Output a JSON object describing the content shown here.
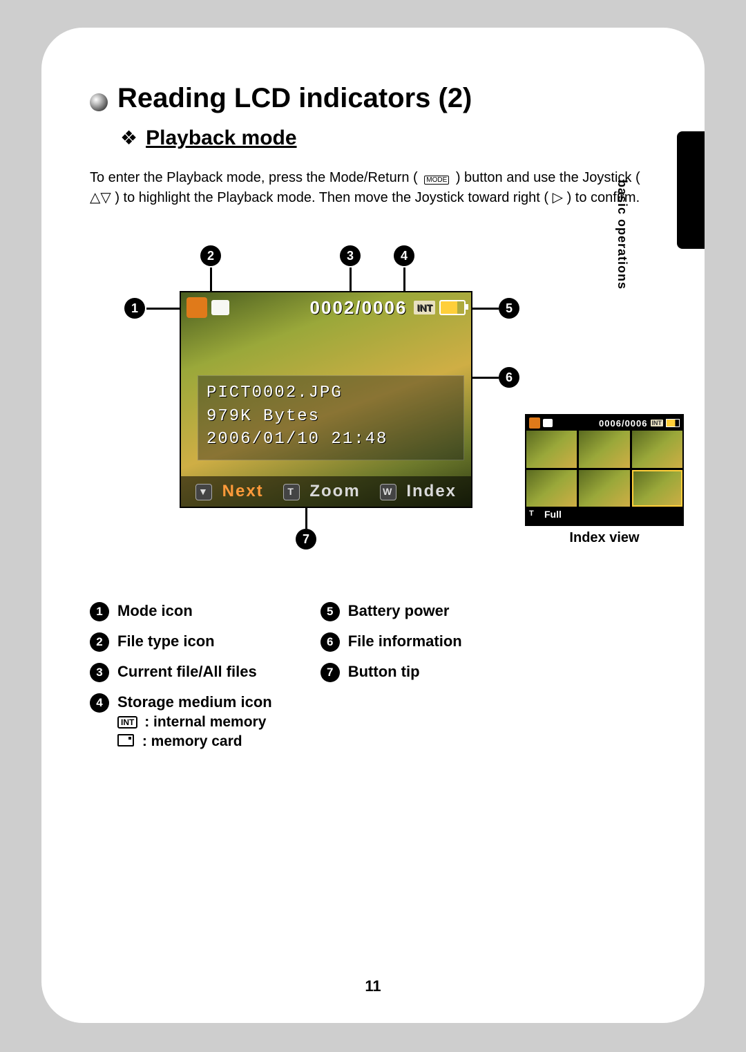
{
  "side_tab_label": "basic operations",
  "title": "Reading LCD indicators (2)",
  "subtitle": "Playback mode",
  "intro_parts": {
    "a": "To enter the Playback mode, press the Mode/Return (",
    "mode_icon_text": "MODE",
    "b": ") button and use the Joystick (",
    "joy_glyph": "△▽",
    "c": ") to highlight the Playback mode. Then move the Joystick toward right (",
    "right_glyph": "▷",
    "d": ") to confirm."
  },
  "lcd": {
    "counter": "0002/0006",
    "int_label": "INT",
    "file_name": "PICT0002.JPG",
    "file_size": "979K Bytes",
    "timestamp": "2006/01/10 21:48",
    "bottom": {
      "next_glyph_hint": "▼",
      "next_label": "Next",
      "zoom_glyph_hint": "T",
      "zoom_label": "Zoom",
      "index_glyph_hint": "W",
      "index_label": "Index"
    }
  },
  "index_view": {
    "counter": "0006/0006",
    "int_label": "INT",
    "full_glyph_hint": "T",
    "full_label": "Full",
    "caption": "Index view"
  },
  "callouts": [
    "1",
    "2",
    "3",
    "4",
    "5",
    "6",
    "7"
  ],
  "legend_left": [
    {
      "n": "1",
      "label": "Mode icon"
    },
    {
      "n": "2",
      "label": "File type icon"
    },
    {
      "n": "3",
      "label": "Current file/All files"
    },
    {
      "n": "4",
      "label": "Storage medium icon",
      "sub_int": ": internal memory",
      "sub_card": ": memory card",
      "int_box": "INT"
    }
  ],
  "legend_right": [
    {
      "n": "5",
      "label": "Battery power"
    },
    {
      "n": "6",
      "label": "File information"
    },
    {
      "n": "7",
      "label": "Button tip"
    }
  ],
  "page_number": "11"
}
